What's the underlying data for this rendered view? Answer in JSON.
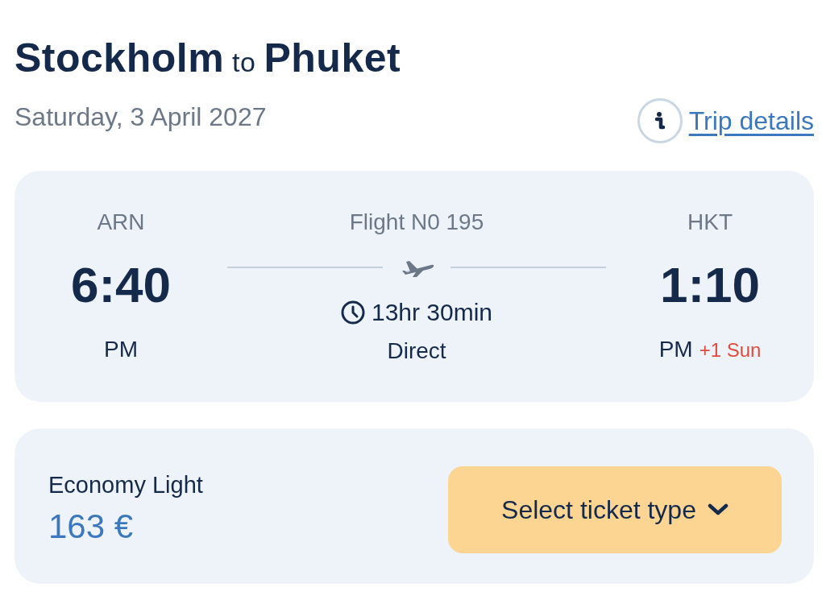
{
  "header": {
    "origin_city": "Stockholm",
    "connector": "to",
    "destination_city": "Phuket",
    "date": "Saturday, 3 April 2027",
    "trip_details_link": "Trip details"
  },
  "flight": {
    "departure": {
      "airport": "ARN",
      "time": "6:40",
      "period": "PM"
    },
    "flight_number": "Flight N0 195",
    "duration": "13hr 30min",
    "stops": "Direct",
    "arrival": {
      "airport": "HKT",
      "time": "1:10",
      "period": "PM",
      "day_offset": "+1 Sun"
    }
  },
  "fare": {
    "name": "Economy Light",
    "price": "163 €",
    "button": "Select ticket type"
  }
}
